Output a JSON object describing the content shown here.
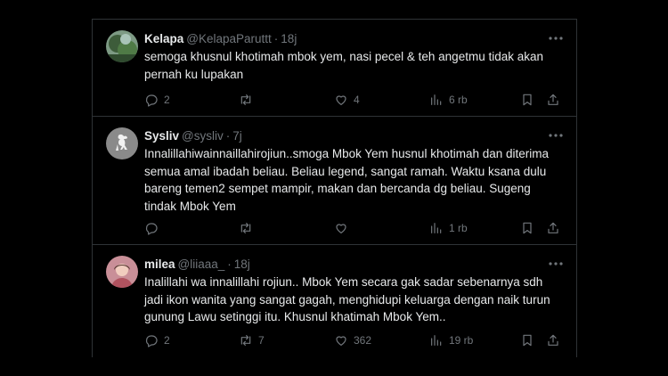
{
  "tweets": [
    {
      "name": "Kelapa",
      "handle": "@KelapaParuttt",
      "time": "18j",
      "text": "semoga khusnul khotimah mbok yem, nasi pecel & teh angetmu tidak akan pernah ku lupakan",
      "replies": "2",
      "retweets": "",
      "likes": "4",
      "views": "6 rb",
      "avatar": "nature-photo"
    },
    {
      "name": "Sysliv",
      "handle": "@sysliv",
      "time": "7j",
      "text": "Innalillahiwainnaillahirojiun..smoga Mbok Yem husnul khotimah dan diterima semua amal ibadah beliau. Beliau legend, sangat ramah. Waktu ksana dulu bareng temen2 sempet mampir, makan dan bercanda dg beliau. Sugeng tindak Mbok Yem",
      "replies": "",
      "retweets": "",
      "likes": "",
      "views": "1 rb",
      "avatar": "liverbird-logo"
    },
    {
      "name": "milea",
      "handle": "@liiaaa_",
      "time": "18j",
      "text": "Inalillahi wa innalillahi rojiun.. Mbok Yem secara gak sadar sebenarnya sdh jadi ikon wanita yang sangat gagah, menghidupi keluarga dengan naik turun gunung Lawu setinggi itu. Khusnul khatimah Mbok Yem..",
      "replies": "2",
      "retweets": "7",
      "likes": "362",
      "views": "19 rb",
      "avatar": "portrait-photo"
    }
  ],
  "icons": [
    "reply-icon",
    "retweet-icon",
    "like-icon",
    "views-icon",
    "bookmark-icon",
    "share-icon",
    "more-icon"
  ],
  "colors": {
    "background": "#000000",
    "text": "#e7e9ea",
    "muted": "#71767b",
    "border": "#2f3336"
  }
}
